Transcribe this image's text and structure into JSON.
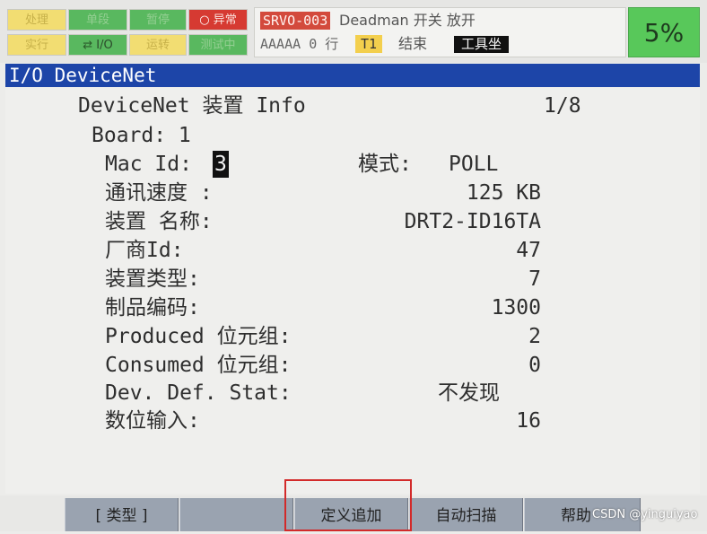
{
  "status_leds": {
    "row1": [
      {
        "label": "处理",
        "color": "yellow"
      },
      {
        "label": "单段",
        "color": "green"
      },
      {
        "label": "暂停",
        "color": "green"
      },
      {
        "label": "异常",
        "color": "red",
        "icon": "circle-icon"
      }
    ],
    "row2": [
      {
        "label": "实行",
        "color": "yellow"
      },
      {
        "label": "I/O",
        "color": "green",
        "icon": "io-arrows-icon"
      },
      {
        "label": "运转",
        "color": "yellow"
      },
      {
        "label": "测试中",
        "color": "green"
      }
    ]
  },
  "alarm": {
    "code": "SRVO-003",
    "message": "Deadman  开关 放开"
  },
  "program": {
    "name": "AAAAA",
    "line": "0 行",
    "task": "T1",
    "status": "结束",
    "coord_system": "工具坐"
  },
  "override": "5%",
  "title": "I/O DeviceNet",
  "screen": {
    "header": "DeviceNet 装置 Info",
    "page": "1/8",
    "board": "Board: 1",
    "mac_label": "Mac Id:",
    "mac_value": "3",
    "mode_label": "模式:",
    "mode_value": "POLL",
    "rows": [
      {
        "label": "通讯速度 :",
        "value": "125 KB"
      },
      {
        "label": "装置 名称:",
        "value": "DRT2-ID16TA"
      },
      {
        "label": "厂商Id:",
        "value": "47"
      },
      {
        "label": "装置类型:",
        "value": "7"
      },
      {
        "label": "制品编码:",
        "value": "1300"
      },
      {
        "label": "Produced 位元组:",
        "value": "2"
      },
      {
        "label": "Consumed 位元组:",
        "value": "0"
      },
      {
        "label": "Dev. Def. Stat:",
        "value": "不发现"
      },
      {
        "label": "数位输入:",
        "value": "16"
      }
    ]
  },
  "function_keys": [
    "[ 类型 ]",
    "",
    "定义追加",
    "自动扫描",
    "帮助"
  ],
  "watermark": "CSDN @yinguiyao",
  "colors": {
    "title_bar": "#1d45a8",
    "override_bg": "#58c85a",
    "alarm_code_bg": "#d34a3c",
    "highlight_border": "#d22a2a"
  }
}
